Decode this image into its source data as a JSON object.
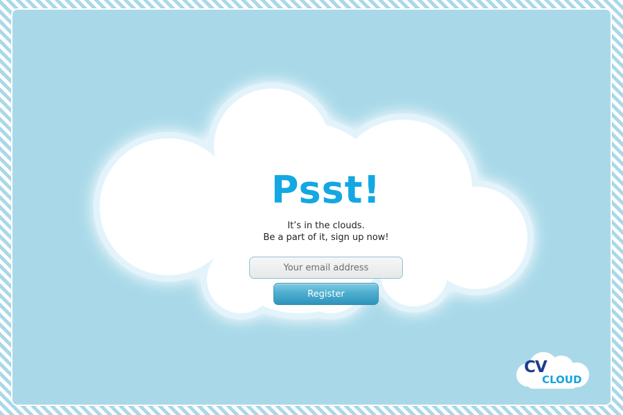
{
  "hero": {
    "title": "Psst!",
    "tagline_line1": "It’s in the clouds.",
    "tagline_line2": "Be a part of it, sign up now!"
  },
  "signup": {
    "email_placeholder": "Your email address",
    "register_label": "Register"
  },
  "brand": {
    "logo_top": "CV",
    "logo_bottom": "CLOUD"
  },
  "colors": {
    "sky": "#a9d9e9",
    "title_blue": "#13a7e3",
    "logo_navy": "#1e3c8f",
    "button_blue": "#4eaecf"
  },
  "icons": {
    "cloud_shape": "cloud",
    "logo": "cv-cloud-logo"
  }
}
